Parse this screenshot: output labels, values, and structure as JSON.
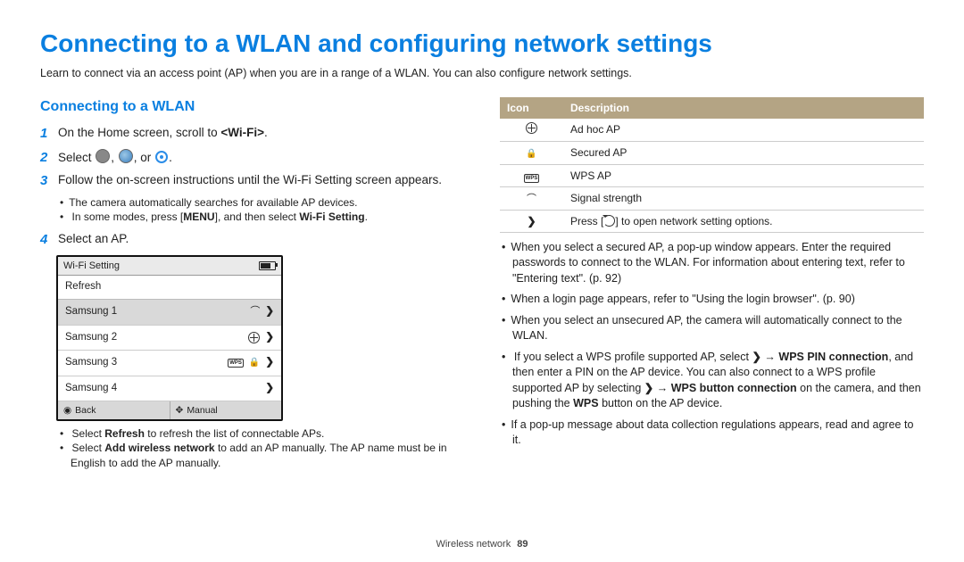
{
  "title": "Connecting to a WLAN and configuring network settings",
  "intro": "Learn to connect via an access point (AP) when you are in a range of a WLAN. You can also configure network settings.",
  "section": "Connecting to a WLAN",
  "steps": {
    "s1_a": "On the Home screen, scroll to ",
    "s1_b": "<Wi-Fi>",
    "s1_c": ".",
    "s2_a": "Select ",
    "s2_b": ", or ",
    "s2_c": ".",
    "s3": "Follow the on-screen instructions until the Wi-Fi Setting screen appears.",
    "s3sub1": "The camera automatically searches for available AP devices.",
    "s3sub2a": "In some modes, press [",
    "s3sub2b": "MENU",
    "s3sub2c": "], and then select ",
    "s3sub2d": "Wi-Fi Setting",
    "s3sub2e": ".",
    "s4": "Select an AP.",
    "s4sub1a": "Select ",
    "s4sub1b": "Refresh",
    "s4sub1c": " to refresh the list of connectable APs.",
    "s4sub2a": "Select ",
    "s4sub2b": "Add wireless network",
    "s4sub2c": " to add an AP manually. The AP name must be in English to add the AP manually."
  },
  "device": {
    "title": "Wi-Fi Setting",
    "refresh": "Refresh",
    "rows": [
      "Samsung 1",
      "Samsung 2",
      "Samsung 3",
      "Samsung 4"
    ],
    "back": "Back",
    "manual": "Manual"
  },
  "table": {
    "h1": "Icon",
    "h2": "Description",
    "r1": "Ad hoc AP",
    "r2": "Secured AP",
    "r3": "WPS AP",
    "r4": "Signal strength",
    "r5a": "Press [",
    "r5b": "] to open network setting options."
  },
  "bullets": {
    "b1": "When you select a secured AP, a pop-up window appears. Enter the required passwords to connect to the WLAN. For information about entering text, refer to \"Entering text\". (p. 92)",
    "b2": "When a login page appears, refer to \"Using the login browser\". (p. 90)",
    "b3": "When you select an unsecured AP, the camera will automatically connect to the WLAN.",
    "b4a": "If you select a WPS profile supported AP, select ",
    "b4b": " → ",
    "b4c": "WPS PIN connection",
    "b4d": ", and then enter a PIN on the AP device. You can also connect to a WPS profile supported AP by selecting ",
    "b4e": " → ",
    "b4f": "WPS button connection",
    "b4g": " on the camera, and then pushing the ",
    "b4h": "WPS",
    "b4i": " button on the AP device.",
    "b5": "If a pop-up message about data collection regulations appears, read and agree to it."
  },
  "footer_a": "Wireless network",
  "footer_b": "89"
}
